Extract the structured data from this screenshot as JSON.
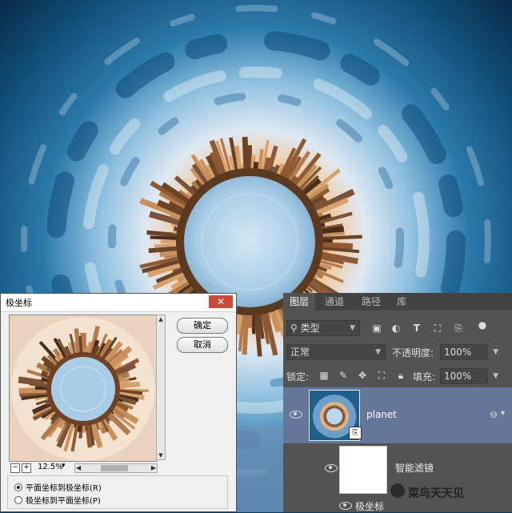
{
  "dialog": {
    "title": "极坐标",
    "close_glyph": "✕",
    "ok_label": "确定",
    "cancel_label": "取消",
    "zoom_level": "12.5%",
    "zoom_minus": "−",
    "zoom_plus": "+",
    "options": [
      {
        "label": "平面坐标到极坐标(R)",
        "selected": true
      },
      {
        "label": "极坐标到平面坐标(P)",
        "selected": false
      }
    ]
  },
  "layers_panel": {
    "tabs": [
      "图层",
      "通道",
      "路径",
      "库"
    ],
    "active_tab": "图层",
    "filter_kind": "类型",
    "blend_mode": "正常",
    "opacity_label": "不透明度:",
    "opacity_value": "100%",
    "lock_label": "锁定:",
    "fill_label": "填充:",
    "fill_value": "100%",
    "layers": [
      {
        "name": "planet",
        "type": "smart-object",
        "visible": true,
        "selected": true
      },
      {
        "name": "智能滤镜",
        "type": "smart-filter-mask",
        "visible": true
      },
      {
        "name": "极坐标",
        "type": "filter",
        "visible": true
      }
    ]
  },
  "watermark": {
    "text": "菜鸟天天见"
  },
  "colors": {
    "panel_bg": "#535353",
    "selected_layer": "#64779b",
    "sky_blue": "#1f5f8e"
  }
}
